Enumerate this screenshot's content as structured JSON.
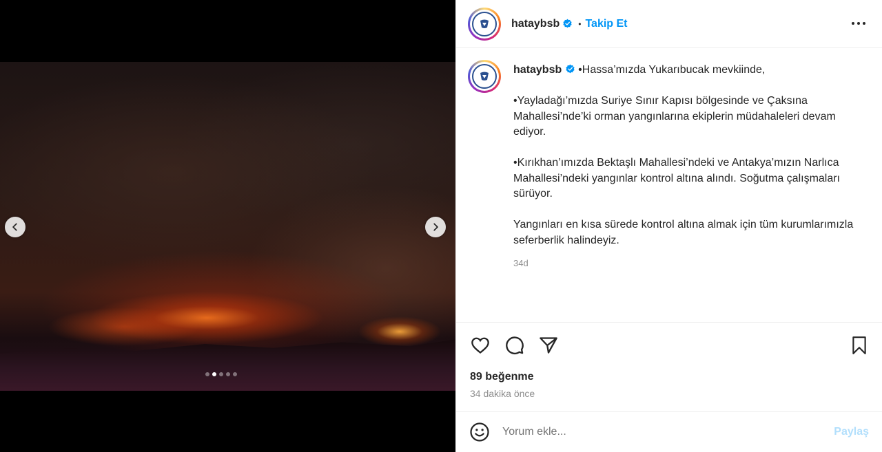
{
  "post": {
    "username": "hataybsb",
    "verified": true,
    "separator": "•",
    "follow_label": "Takip Et",
    "caption_paragraphs": [
      "•Hassa’mızda Yukarıbucak mevkiinde,",
      "•Yayladağı’mızda Suriye Sınır Kapısı bölgesinde ve Çaksına Mahallesi’nde’ki orman yangınlarına ekiplerin müdahaleleri devam ediyor.",
      "•Kırıkhan’ımızda Bektaşlı Mahallesi’ndeki ve Antakya’mızın Narlıca Mahallesi’ndeki yangınlar kontrol altına alındı. Soğutma çalışmaları sürüyor.",
      "Yangınları en kısa sürede kontrol altına almak için tüm kurumlarımızla seferberlik halindeyiz."
    ],
    "caption_time": "34d",
    "likes": "89 beğenme",
    "posted_ago": "34 dakika önce",
    "carousel": {
      "total": 5,
      "active_index": 1
    }
  },
  "comment": {
    "placeholder": "Yorum ekle...",
    "post_label": "Paylaş"
  },
  "colors": {
    "accent": "#0095f6",
    "verified": "#0095f6",
    "muted": "#8e8e8e"
  },
  "icons": {
    "prev": "chevron-left-icon",
    "next": "chevron-right-icon",
    "more": "more-horizontal-icon",
    "like": "heart-icon",
    "comment": "comment-bubble-icon",
    "share": "send-icon",
    "save": "bookmark-icon",
    "emoji": "emoji-icon"
  }
}
